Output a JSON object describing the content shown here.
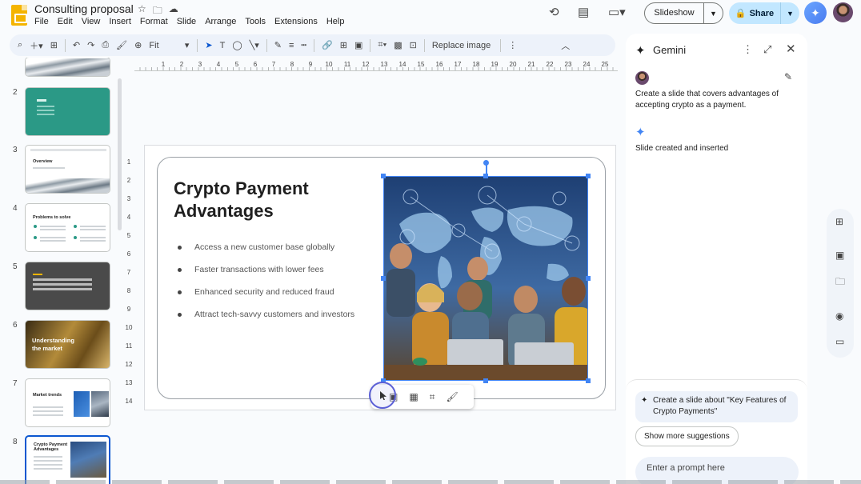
{
  "app": {
    "title": "Consulting proposal",
    "title_icons": [
      "star-icon",
      "move-to-folder-icon",
      "cloud-status-icon"
    ],
    "menu": [
      "File",
      "Edit",
      "View",
      "Insert",
      "Format",
      "Slide",
      "Arrange",
      "Tools",
      "Extensions",
      "Help"
    ]
  },
  "header": {
    "slideshow_label": "Slideshow",
    "share_label": "Share",
    "accent": "#c2e7ff"
  },
  "toolbar": {
    "zoom": "Fit",
    "replace_image_label": "Replace image"
  },
  "rulers": {
    "horizontal": [
      "1",
      "2",
      "3",
      "4",
      "5",
      "6",
      "7",
      "8",
      "9",
      "10",
      "11",
      "12",
      "13",
      "14",
      "15",
      "16",
      "17",
      "18",
      "19",
      "20",
      "21",
      "22",
      "23",
      "24",
      "25"
    ],
    "vertical": [
      "1",
      "2",
      "3",
      "4",
      "5",
      "6",
      "7",
      "8",
      "9",
      "10",
      "11",
      "12",
      "13",
      "14"
    ]
  },
  "filmstrip": {
    "slides": [
      {
        "num": "2",
        "title": "Title"
      },
      {
        "num": "3",
        "title": "Overview"
      },
      {
        "num": "4",
        "title": "Problems to solve"
      },
      {
        "num": "5",
        "title": "Lorem ipsum dolor sit amet, consectetur adipiscing elit, sed do eiusmod tempor incididunt ut labore et dolore magna aliqua."
      },
      {
        "num": "6",
        "title": "Understanding the market"
      },
      {
        "num": "7",
        "title": "Market trends"
      },
      {
        "num": "8",
        "title": "Crypto Payment Advantages"
      }
    ]
  },
  "slide": {
    "title": "Crypto Payment Advantages",
    "bullets": [
      "Access a new customer base globally",
      "Faster transactions with lower fees",
      "Enhanced security and reduced fraud",
      "Attract tech-savvy customers and investors"
    ]
  },
  "gemini": {
    "title": "Gemini",
    "user_prompt": "Create a slide that covers advantages of accepting crypto as a payment.",
    "reply": "Slide created and inserted",
    "suggestion": "Create a slide about \"Key Features of Crypto Payments\"",
    "show_more_label": "Show more suggestions",
    "input_placeholder": "Enter a prompt here"
  }
}
